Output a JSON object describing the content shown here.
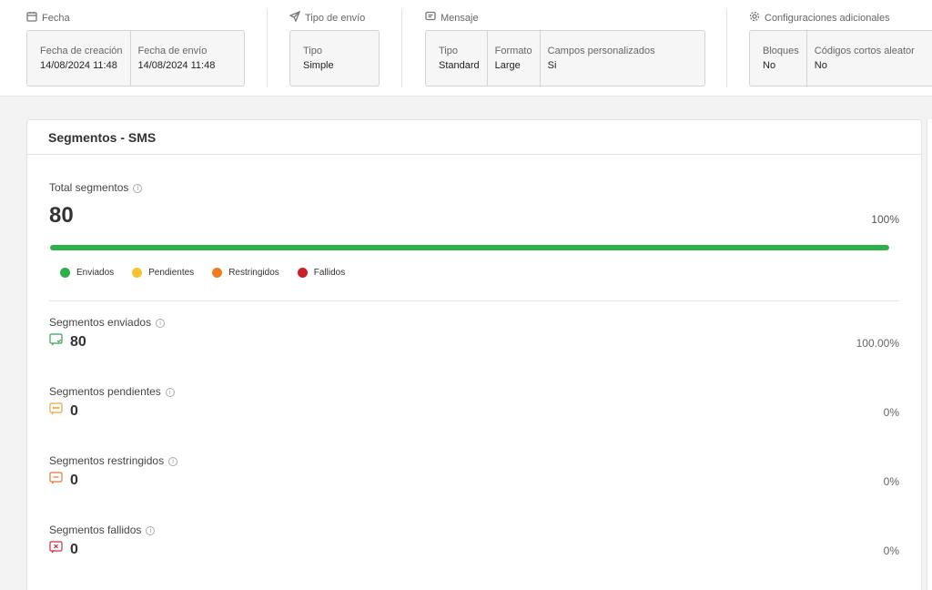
{
  "header": {
    "fecha": {
      "title": "Fecha",
      "fields": [
        {
          "label": "Fecha de creación",
          "value": "14/08/2024 11:48"
        },
        {
          "label": "Fecha de envío",
          "value": "14/08/2024 11:48"
        }
      ]
    },
    "tipo_envio": {
      "title": "Tipo de envío",
      "fields": [
        {
          "label": "Tipo",
          "value": "Simple"
        }
      ]
    },
    "mensaje": {
      "title": "Mensaje",
      "fields": [
        {
          "label": "Tipo",
          "value": "Standard"
        },
        {
          "label": "Formato",
          "value": "Large"
        },
        {
          "label": "Campos personalizados",
          "value": "Si"
        }
      ]
    },
    "config": {
      "title": "Configuraciones adicionales",
      "fields": [
        {
          "label": "Bloques",
          "value": "No"
        },
        {
          "label": "Códigos cortos aleator",
          "value": "No"
        }
      ]
    }
  },
  "card": {
    "title": "Segmentos - SMS",
    "total": {
      "label": "Total segmentos",
      "value": "80",
      "percent": "100%",
      "progress_fraction": 1.0
    },
    "legend": [
      {
        "label": "Enviados",
        "color": "#2bb04a"
      },
      {
        "label": "Pendientes",
        "color": "#f5c531"
      },
      {
        "label": "Restringidos",
        "color": "#f07c22"
      },
      {
        "label": "Fallidos",
        "color": "#c8202c"
      }
    ],
    "segments": [
      {
        "label": "Segmentos enviados",
        "value": "80",
        "percent": "100.00%",
        "icon": "sms-sent-icon",
        "color": "#3aa05a"
      },
      {
        "label": "Segmentos pendientes",
        "value": "0",
        "percent": "0%",
        "icon": "sms-pending-icon",
        "color": "#f0a53a"
      },
      {
        "label": "Segmentos restringidos",
        "value": "0",
        "percent": "0%",
        "icon": "sms-restricted-icon",
        "color": "#e8743a"
      },
      {
        "label": "Segmentos fallidos",
        "value": "0",
        "percent": "0%",
        "icon": "sms-failed-icon",
        "color": "#c8303a"
      }
    ]
  }
}
